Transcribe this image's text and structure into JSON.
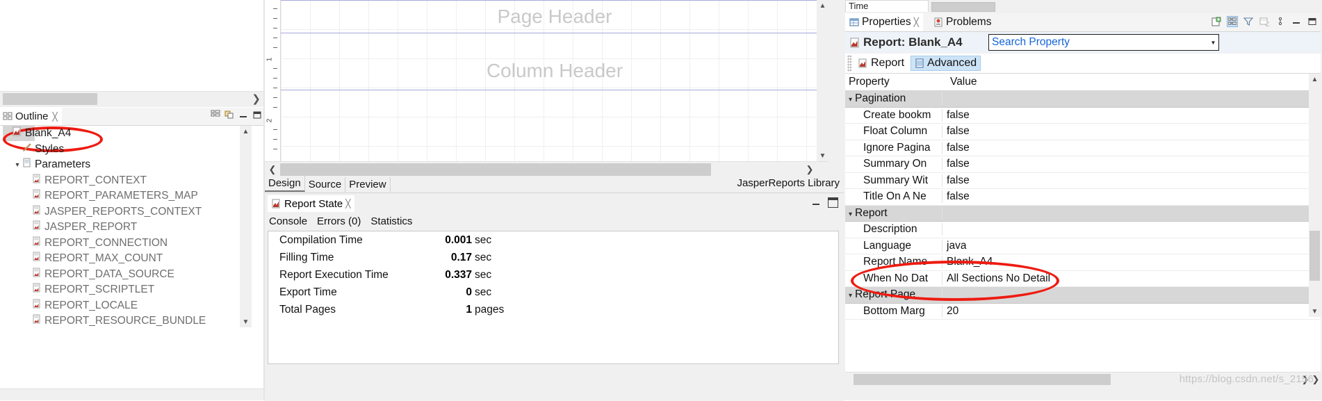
{
  "outline": {
    "tab_label": "Outline",
    "close_icon": "close-x-icon",
    "toolbar_icons": [
      "collapse-all-icon",
      "link-with-editor-icon",
      "minimize-icon",
      "maximize-icon"
    ],
    "tree": [
      {
        "label": "Blank_A4",
        "depth": 0,
        "icon": "report-icon",
        "selected": true,
        "twisty": ""
      },
      {
        "label": "Styles",
        "depth": 1,
        "icon": "pencil-icon",
        "selected": false,
        "twisty": ""
      },
      {
        "label": "Parameters",
        "depth": 1,
        "icon": "parameters-icon",
        "selected": false,
        "twisty": "v"
      },
      {
        "label": "REPORT_CONTEXT",
        "depth": 2,
        "icon": "parameter-icon",
        "selected": false,
        "twisty": ""
      },
      {
        "label": "REPORT_PARAMETERS_MAP",
        "depth": 2,
        "icon": "parameter-icon",
        "selected": false,
        "twisty": ""
      },
      {
        "label": "JASPER_REPORTS_CONTEXT",
        "depth": 2,
        "icon": "parameter-icon",
        "selected": false,
        "twisty": ""
      },
      {
        "label": "JASPER_REPORT",
        "depth": 2,
        "icon": "parameter-icon",
        "selected": false,
        "twisty": ""
      },
      {
        "label": "REPORT_CONNECTION",
        "depth": 2,
        "icon": "parameter-icon",
        "selected": false,
        "twisty": ""
      },
      {
        "label": "REPORT_MAX_COUNT",
        "depth": 2,
        "icon": "parameter-icon",
        "selected": false,
        "twisty": ""
      },
      {
        "label": "REPORT_DATA_SOURCE",
        "depth": 2,
        "icon": "parameter-icon",
        "selected": false,
        "twisty": ""
      },
      {
        "label": "REPORT_SCRIPTLET",
        "depth": 2,
        "icon": "parameter-icon",
        "selected": false,
        "twisty": ""
      },
      {
        "label": "REPORT_LOCALE",
        "depth": 2,
        "icon": "parameter-icon",
        "selected": false,
        "twisty": ""
      },
      {
        "label": "REPORT_RESOURCE_BUNDLE",
        "depth": 2,
        "icon": "parameter-icon",
        "selected": false,
        "twisty": ""
      }
    ]
  },
  "designer": {
    "bands": [
      {
        "label": "Page Header"
      },
      {
        "label": "Column Header"
      }
    ],
    "ruler_marks": [
      "1",
      "2"
    ],
    "tabs": [
      {
        "label": "Design",
        "active": true
      },
      {
        "label": "Source",
        "active": false
      },
      {
        "label": "Preview",
        "active": false
      }
    ],
    "status_right": "JasperReports Library",
    "scroll_left_icon": "chevron-left-icon",
    "scroll_right_icon": "chevron-right-icon"
  },
  "report_state": {
    "tab_label": "Report State",
    "close_icon": "close-x-icon",
    "subtabs": [
      {
        "label": "Console",
        "active": false
      },
      {
        "label": "Errors (0)",
        "active": false
      },
      {
        "label": "Statistics",
        "active": true
      }
    ],
    "stats": [
      {
        "name": "Compilation Time",
        "value": "0.001",
        "unit": "sec"
      },
      {
        "name": "Filling Time",
        "value": "0.17",
        "unit": "sec"
      },
      {
        "name": "Report Execution Time",
        "value": "0.337",
        "unit": "sec"
      },
      {
        "name": "Export Time",
        "value": "0",
        "unit": "sec"
      },
      {
        "name": "Total Pages",
        "value": "1",
        "unit": "pages"
      }
    ],
    "minimize_icon": "minimize-icon",
    "maximize_icon": "maximize-icon"
  },
  "properties": {
    "top_minitab_label": "Time",
    "tabs": [
      {
        "label": "Properties",
        "icon": "properties-icon",
        "active": true,
        "close_icon": "close-x-icon"
      },
      {
        "label": "Problems",
        "icon": "problems-icon",
        "active": false
      }
    ],
    "toolbar_icons": [
      "new-view-icon",
      "show-categories-icon",
      "filter-icon",
      "restore-defaults-icon",
      "view-menu-icon",
      "minimize-icon",
      "maximize-icon"
    ],
    "title": "Report: Blank_A4",
    "title_icon": "report-icon",
    "search_placeholder": "Search Property",
    "search_value": "",
    "search_dropdown_icon": "chevron-down-icon",
    "subtabs": [
      {
        "label": "Report",
        "icon": "report-icon",
        "active": false
      },
      {
        "label": "Advanced",
        "icon": "advanced-icon",
        "active": true
      }
    ],
    "table": {
      "headers": [
        "Property",
        "Value"
      ],
      "rows": [
        {
          "type": "group",
          "name": "Pagination",
          "value": ""
        },
        {
          "type": "child",
          "name": "Create bookm",
          "value": "false"
        },
        {
          "type": "child",
          "name": "Float Column",
          "value": "false"
        },
        {
          "type": "child",
          "name": "Ignore Pagina",
          "value": "false"
        },
        {
          "type": "child",
          "name": "Summary On",
          "value": "false"
        },
        {
          "type": "child",
          "name": "Summary Wit",
          "value": "false"
        },
        {
          "type": "child",
          "name": "Title On A Ne",
          "value": "false"
        },
        {
          "type": "group",
          "name": "Report",
          "value": ""
        },
        {
          "type": "child",
          "name": "Description",
          "value": ""
        },
        {
          "type": "child",
          "name": "Language",
          "value": "java"
        },
        {
          "type": "child",
          "name": "Report Name",
          "value": "Blank_A4"
        },
        {
          "type": "child",
          "name": "When No Dat",
          "value": "All Sections No Detail"
        },
        {
          "type": "group",
          "name": "Report Page",
          "value": ""
        },
        {
          "type": "child",
          "name": "Bottom Marg",
          "value": "20"
        }
      ]
    }
  },
  "watermark": "https://blog.csdn.net/s_2156",
  "colors": {
    "accent_blue": "#1565d8",
    "annotation_red": "#ee1b11",
    "band_line": "#a6a8dd",
    "band_text": "#c9c9c9",
    "selection": "#cde3f7"
  }
}
